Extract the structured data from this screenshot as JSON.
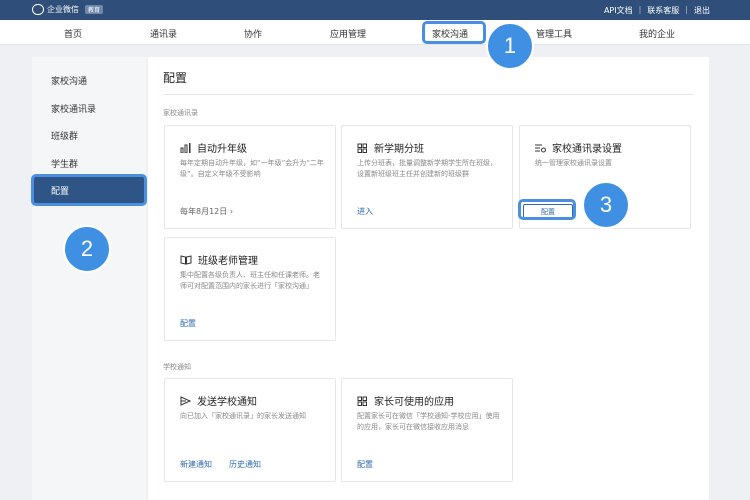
{
  "topbar": {
    "brand": "企业微信",
    "badge": "教育",
    "links": [
      "API文档",
      "联系客服",
      "退出"
    ]
  },
  "nav": {
    "items": [
      "首页",
      "通讯录",
      "协作",
      "应用管理",
      "家校沟通",
      "管理工具",
      "我的企业"
    ]
  },
  "sidebar": {
    "items": [
      "家校沟通",
      "家校通讯录",
      "班级群",
      "学生群",
      "配置"
    ]
  },
  "main": {
    "title": "配置",
    "sections": [
      "家校通讯录",
      "学校通知"
    ]
  },
  "cards": {
    "auto_upgrade": {
      "title": "自动升年级",
      "desc": "每年定期自动升年级，如“一年级”会升为“二年级”。自定义年级不受影响",
      "link": "每年8月12日",
      "icon": "bar-chart-icon"
    },
    "new_term": {
      "title": "新学期分班",
      "desc": "上传分班表，批量调整新学期学生所在班级，设置新班级班主任并创建新的班级群",
      "link": "进入",
      "icon": "grid-icon"
    },
    "contacts_settings": {
      "title": "家校通讯录设置",
      "desc": "统一管理家校通讯录设置",
      "button": "配置",
      "icon": "list-settings-icon"
    },
    "class_teacher": {
      "title": "班级老师管理",
      "desc": "集中配置各级负责人、班主任和任课老师。老师可对配置范围内的家长进行「家校沟通」",
      "link": "配置",
      "icon": "book-icon"
    },
    "send_notice": {
      "title": "发送学校通知",
      "desc": "向已加入「家校通讯录」的家长发送通知",
      "links": [
        "新建通知",
        "历史通知"
      ],
      "icon": "send-icon"
    },
    "parent_apps": {
      "title": "家长可使用的应用",
      "desc": "配置家长可在微信「学校通知-学校应用」使用的应用，家长可在微信接收应用消息",
      "link": "配置",
      "icon": "apps-icon"
    }
  },
  "annotations": [
    "1",
    "2",
    "3"
  ],
  "colors": {
    "topbar": "#2f4f7a",
    "accent": "#2f6bb3",
    "highlight": "#4a8fe0",
    "sidebar_active": "#2f5587"
  }
}
